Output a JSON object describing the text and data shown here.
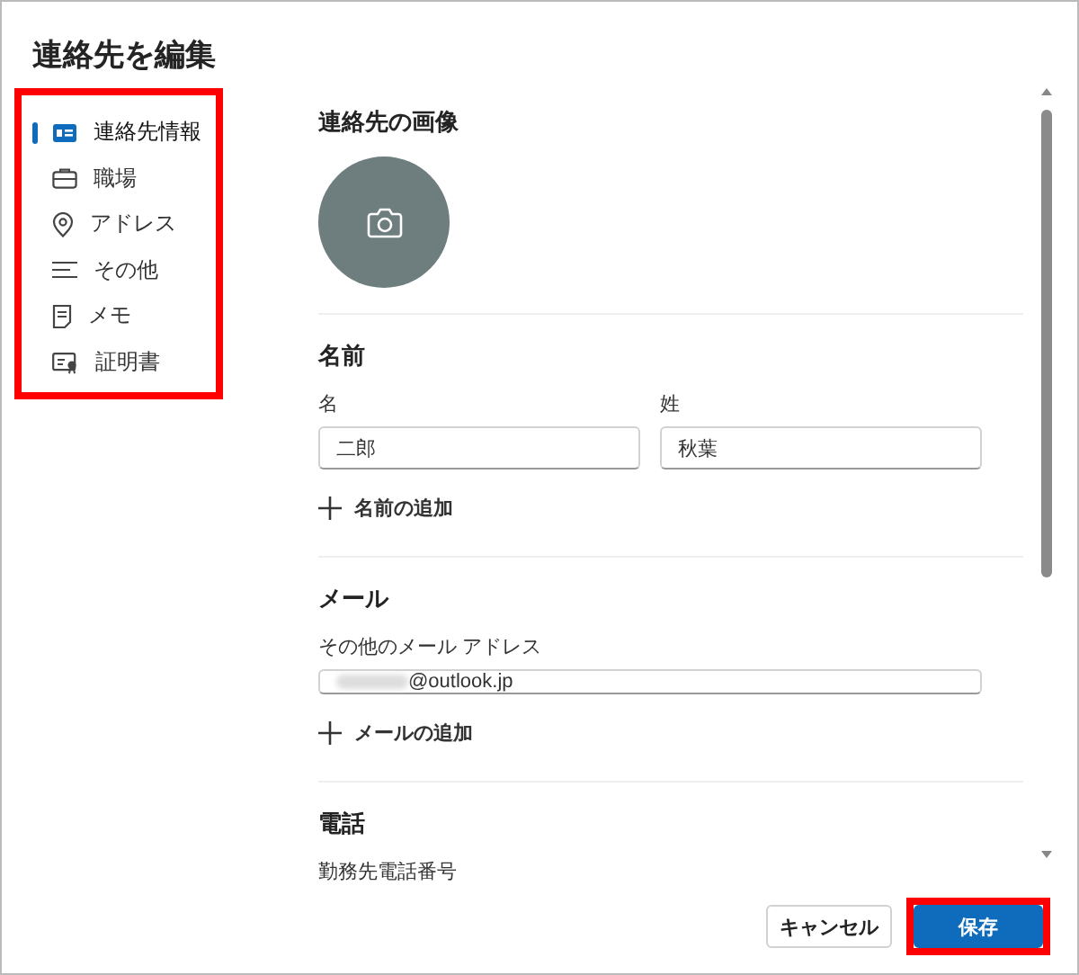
{
  "dialog": {
    "title": "連絡先を編集"
  },
  "sidebar": {
    "highlighted": true,
    "items": [
      {
        "label": "連絡先情報",
        "selected": true
      },
      {
        "label": "職場",
        "selected": false
      },
      {
        "label": "アドレス",
        "selected": false
      },
      {
        "label": "その他",
        "selected": false
      },
      {
        "label": "メモ",
        "selected": false
      },
      {
        "label": "証明書",
        "selected": false
      }
    ]
  },
  "photo": {
    "heading": "連絡先の画像"
  },
  "name": {
    "heading": "名前",
    "fields": [
      {
        "label": "名",
        "value": "二郎"
      },
      {
        "label": "姓",
        "value": "秋葉"
      }
    ],
    "add": "名前の追加"
  },
  "email": {
    "heading": "メール",
    "label": "その他のメール アドレス",
    "value": "@outlook.jp",
    "blurred": true,
    "add": "メールの追加"
  },
  "phone": {
    "heading": "電話",
    "label": "勤務先電話番号"
  },
  "buttons": [
    {
      "label": "キャンセル",
      "kind": "secondary",
      "highlighted": false
    },
    {
      "label": "保存",
      "kind": "primary",
      "highlighted": true
    }
  ]
}
